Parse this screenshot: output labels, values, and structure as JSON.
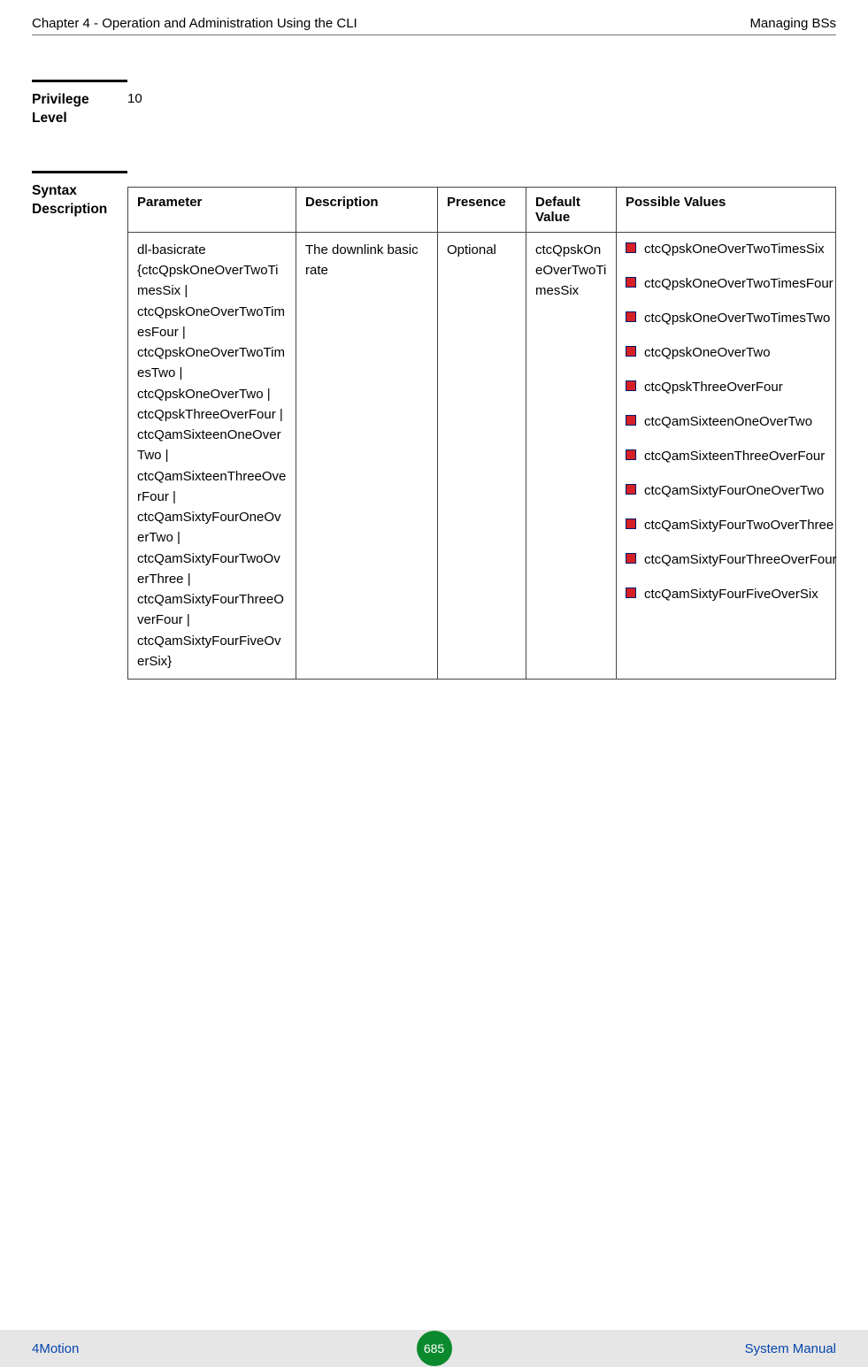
{
  "header": {
    "left": "Chapter 4 - Operation and Administration Using the CLI",
    "right": "Managing BSs"
  },
  "privilege": {
    "label1": "Privilege",
    "label2": "Level",
    "value": "10"
  },
  "syntax": {
    "label1": "Syntax",
    "label2": "Description"
  },
  "table": {
    "headers": {
      "parameter": "Parameter",
      "description": "Description",
      "presence": "Presence",
      "default": "Default Value",
      "possible": "Possible Values"
    },
    "row": {
      "parameter": "dl-basicrate {ctcQpskOneOverTwoTimesSix | ctcQpskOneOverTwoTimesFour | ctcQpskOneOverTwoTimesTwo | ctcQpskOneOverTwo | ctcQpskThreeOverFour | ctcQamSixteenOneOverTwo | ctcQamSixteenThreeOverFour | ctcQamSixtyFourOneOverTwo | ctcQamSixtyFourTwoOverThree | ctcQamSixtyFourThreeOverFour | ctcQamSixtyFourFiveOverSix}",
      "description": "The downlink basic rate",
      "presence": "Optional",
      "default": "ctcQpskOneOverTwoTimesSix",
      "possible": [
        "ctcQpskOneOverTwoTimesSix",
        "ctcQpskOneOverTwoTimesFour",
        "ctcQpskOneOverTwoTimesTwo",
        "ctcQpskOneOverTwo",
        "ctcQpskThreeOverFour",
        "ctcQamSixteenOneOverTwo",
        "ctcQamSixteenThreeOverFour",
        "ctcQamSixtyFourOneOverTwo",
        "ctcQamSixtyFourTwoOverThree",
        "ctcQamSixtyFourThreeOverFour",
        "ctcQamSixtyFourFiveOverSix"
      ]
    }
  },
  "footer": {
    "left": "4Motion",
    "page": "685",
    "right": "System Manual"
  }
}
